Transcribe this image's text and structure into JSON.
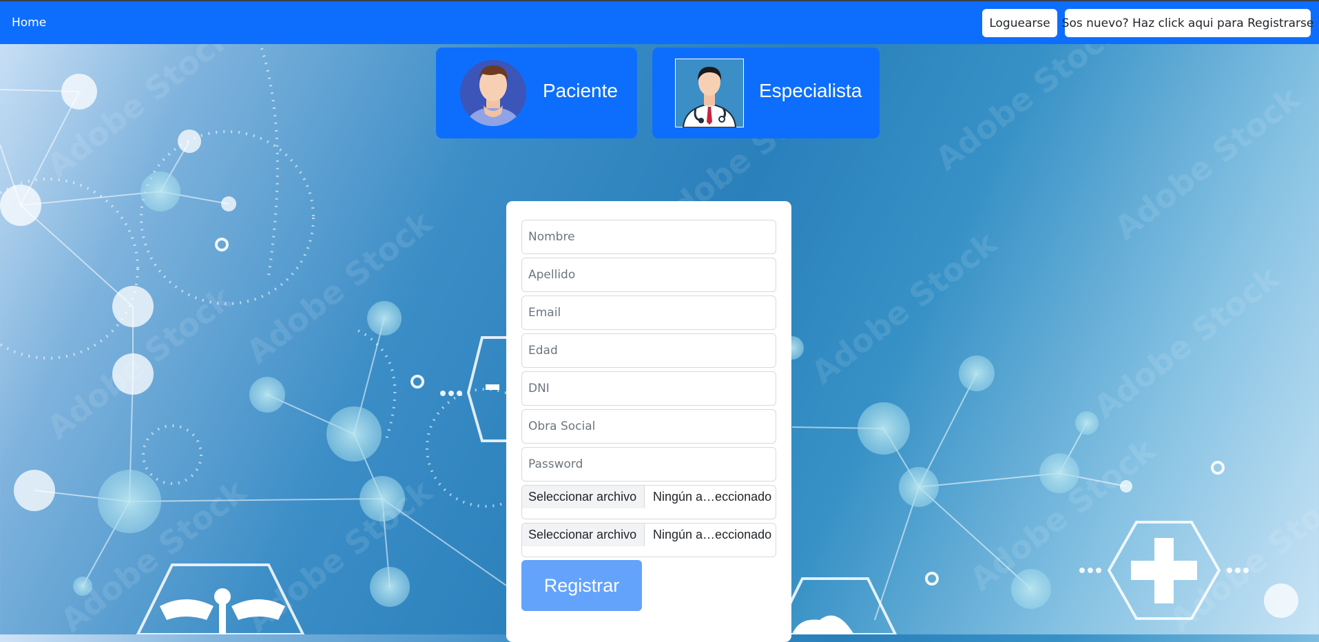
{
  "navbar": {
    "home_label": "Home",
    "login_label": "Loguearse",
    "register_label": "Sos nuevo? Haz click aqui para Registrarse"
  },
  "roles": [
    {
      "label": "Paciente",
      "icon": "patient-avatar-icon"
    },
    {
      "label": "Especialista",
      "icon": "doctor-avatar-icon"
    }
  ],
  "form": {
    "fields": [
      {
        "placeholder": "Nombre",
        "value": ""
      },
      {
        "placeholder": "Apellido",
        "value": ""
      },
      {
        "placeholder": "Email",
        "value": ""
      },
      {
        "placeholder": "Edad",
        "value": ""
      },
      {
        "placeholder": "DNI",
        "value": ""
      },
      {
        "placeholder": "Obra Social",
        "value": ""
      },
      {
        "placeholder": "Password",
        "value": ""
      }
    ],
    "file_inputs": [
      {
        "button_label": "Seleccionar archivo",
        "status": "Ningún a…eccionado"
      },
      {
        "button_label": "Seleccionar archivo",
        "status": "Ningún a…eccionado"
      }
    ],
    "submit_label": "Registrar"
  },
  "background": {
    "watermark_text": "Adobe Stock"
  },
  "colors": {
    "primary": "#0d6efd",
    "submit_disabled": "#63a3fc",
    "card_bg": "#ffffff"
  }
}
